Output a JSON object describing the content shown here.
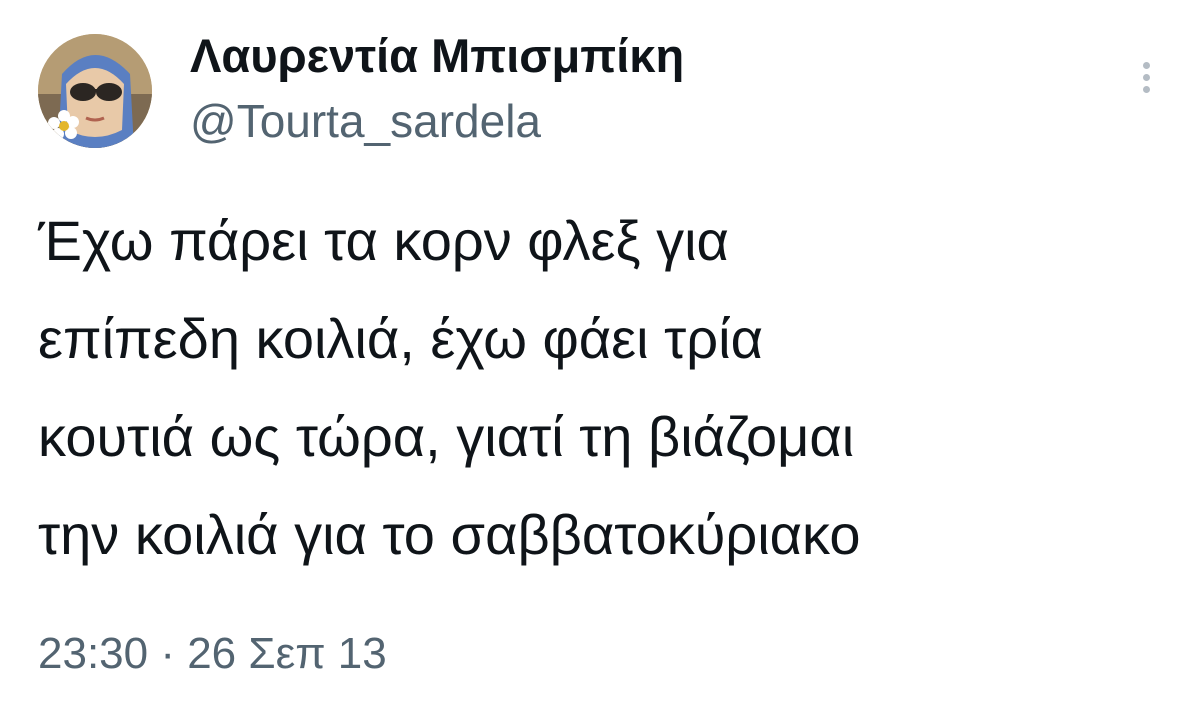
{
  "author": {
    "display_name": "Λαυρεντία Μπισμπίκη",
    "username": "@Tourta_sardela",
    "avatar_icon": "profile-photo-avatar"
  },
  "tweet": {
    "lines": [
      "Έχω πάρει τα κορν φλεξ για",
      "επίπεδη κοιλιά, έχω φάει τρία",
      "κουτιά ως τώρα, γιατί τη βιάζομαι",
      "την κοιλιά για το σαββατοκύριακο"
    ],
    "timestamp": "23:30 · 26 Σεπ 13"
  },
  "menu": {
    "icon": "more-options-icon"
  },
  "colors": {
    "primary_text": "#0f1419",
    "secondary_text": "#536471",
    "background": "#ffffff"
  }
}
